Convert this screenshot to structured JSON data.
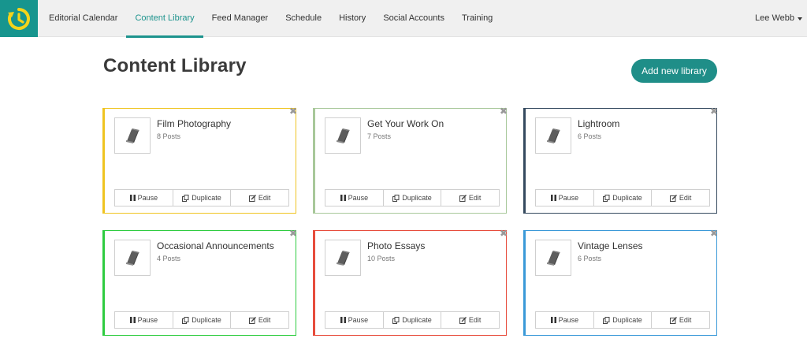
{
  "nav": {
    "items": [
      {
        "label": "Editorial Calendar",
        "active": false
      },
      {
        "label": "Content Library",
        "active": true
      },
      {
        "label": "Feed Manager",
        "active": false
      },
      {
        "label": "Schedule",
        "active": false
      },
      {
        "label": "History",
        "active": false
      },
      {
        "label": "Social Accounts",
        "active": false
      },
      {
        "label": "Training",
        "active": false
      }
    ],
    "user": "Lee Webb",
    "accent": "#1d938d"
  },
  "page": {
    "title": "Content Library",
    "add_button": "Add new library"
  },
  "actions": {
    "pause": "Pause",
    "duplicate": "Duplicate",
    "edit": "Edit"
  },
  "libraries": [
    {
      "name": "Film Photography",
      "posts": "8 Posts",
      "color": "#efc421"
    },
    {
      "name": "Get Your Work On",
      "posts": "7 Posts",
      "color": "#a8c89a"
    },
    {
      "name": "Lightroom",
      "posts": "6 Posts",
      "color": "#34495e"
    },
    {
      "name": "Occasional Announcements",
      "posts": "4 Posts",
      "color": "#2ecc40"
    },
    {
      "name": "Photo Essays",
      "posts": "10 Posts",
      "color": "#e74c3c"
    },
    {
      "name": "Vintage Lenses",
      "posts": "6 Posts",
      "color": "#3a99d8"
    }
  ]
}
